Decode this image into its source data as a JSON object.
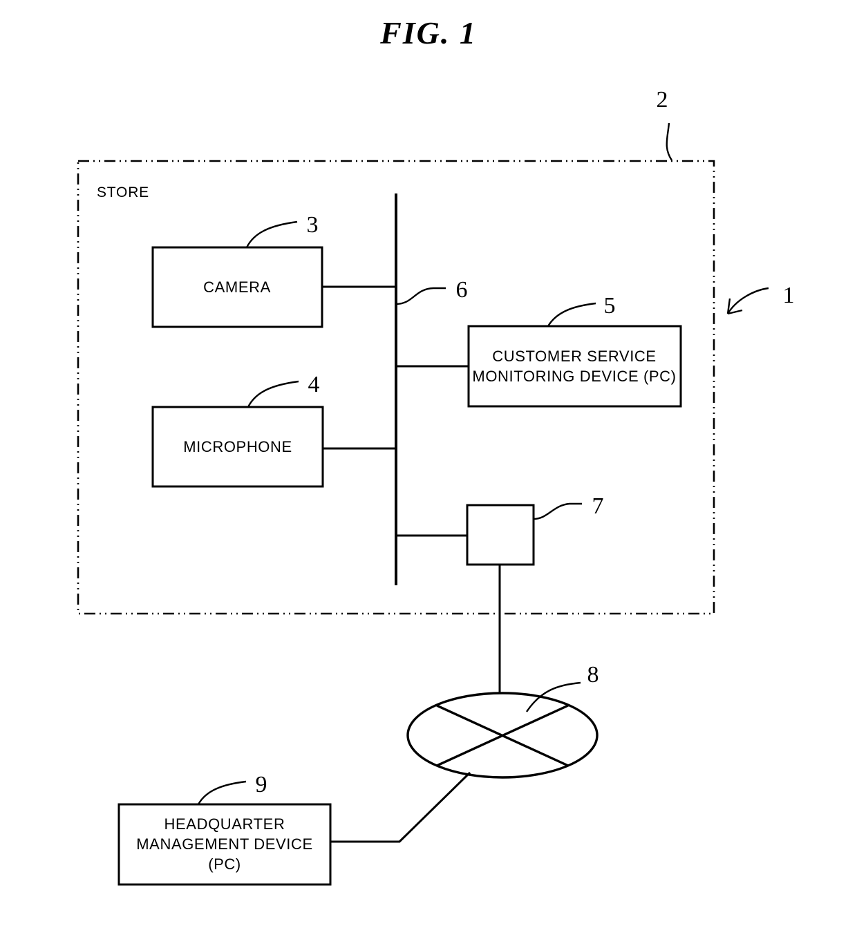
{
  "figure": {
    "title": "FIG. 1",
    "region_label": "STORE"
  },
  "boxes": {
    "camera": {
      "label": "CAMERA",
      "ref": "3"
    },
    "microphone": {
      "label": "MICROPHONE",
      "ref": "4"
    },
    "monitoring_device": {
      "label_line1": "CUSTOMER SERVICE",
      "label_line2": "MONITORING DEVICE (PC)",
      "ref": "5"
    },
    "router": {
      "label": "",
      "ref": "7"
    },
    "headquarter": {
      "label_line1": "HEADQUARTER",
      "label_line2": "MANAGEMENT DEVICE",
      "label_line3": "(PC)",
      "ref": "9"
    }
  },
  "refs": {
    "system": "1",
    "store_region": "2",
    "bus": "6",
    "network": "8"
  },
  "colors": {
    "stroke": "#000000",
    "background": "#ffffff"
  }
}
